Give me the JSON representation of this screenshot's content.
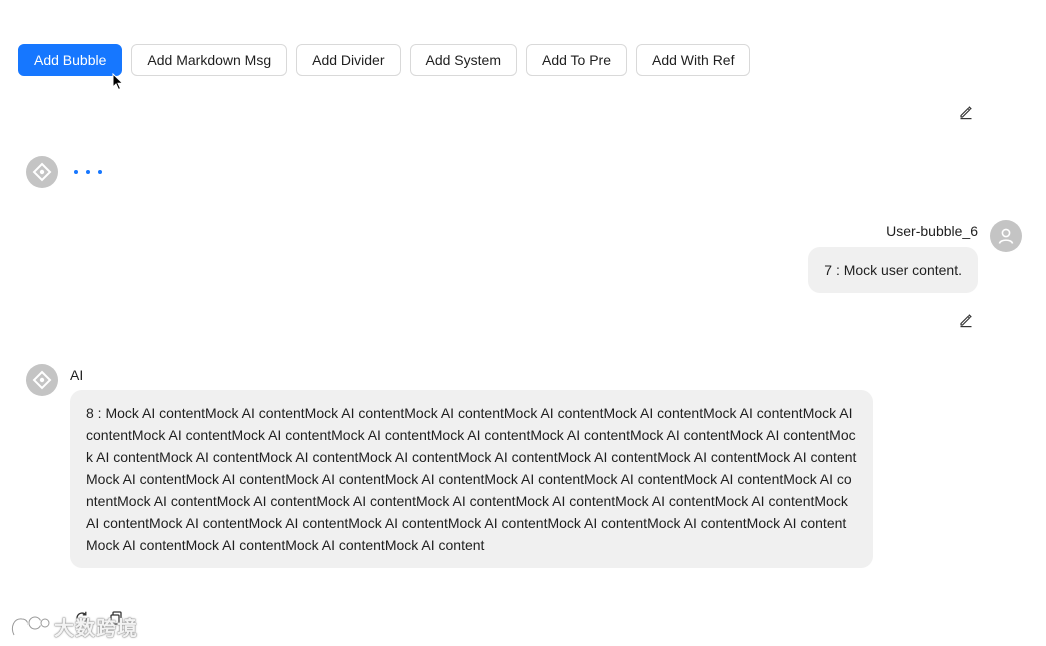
{
  "toolbar": {
    "buttons": [
      {
        "label": "Add Bubble",
        "primary": true
      },
      {
        "label": "Add Markdown Msg"
      },
      {
        "label": "Add Divider"
      },
      {
        "label": "Add System"
      },
      {
        "label": "Add To Pre"
      },
      {
        "label": "Add With Ref"
      }
    ]
  },
  "messages": {
    "user": {
      "name": "User-bubble_6",
      "content": "7 : Mock user content."
    },
    "ai": {
      "name": "AI",
      "content": "8 : Mock AI contentMock AI contentMock AI contentMock AI contentMock AI contentMock AI contentMock AI contentMock AI contentMock AI contentMock AI contentMock AI contentMock AI contentMock AI contentMock AI contentMock AI contentMock AI contentMock AI contentMock AI contentMock AI contentMock AI contentMock AI contentMock AI contentMock AI contentMock AI contentMock AI contentMock AI contentMock AI contentMock AI contentMock AI contentMock AI contentMock AI contentMock AI contentMock AI contentMock AI contentMock AI contentMock AI contentMock AI contentMock AI contentMock AI contentMock AI contentMock AI contentMock AI contentMock AI contentMock AI contentMock AI contentMock AI contentMock AI contentMock AI contentMock AI contentMock AI content"
    }
  },
  "icons": {
    "edit": "edit-icon",
    "ai_avatar": "ai-logo-icon",
    "user_avatar": "user-icon",
    "refresh": "refresh-icon",
    "copy": "copy-icon"
  },
  "colors": {
    "primary": "#1677ff",
    "bubble_bg": "#f0f0f0",
    "avatar_bg": "#c4c4c4"
  },
  "watermark": {
    "text": "大数跨境"
  }
}
